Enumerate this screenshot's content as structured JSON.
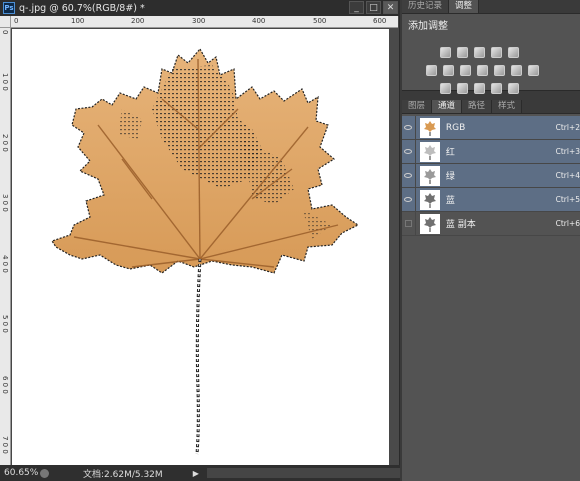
{
  "window": {
    "title": "q-.jpg @ 60.7%(RGB/8#) *",
    "minimize": "_",
    "restore": "□",
    "close": "✕",
    "ps_logo": "Ps"
  },
  "rulers": {
    "top": [
      "0",
      "100",
      "200",
      "300",
      "400",
      "500",
      "600"
    ],
    "left": [
      "0",
      "1\n0\n0",
      "2\n0\n0",
      "3\n0\n0",
      "4\n0\n0",
      "5\n0\n0",
      "6\n0\n0",
      "7\n0\n0",
      "8\n0\n0"
    ]
  },
  "status": {
    "zoom": "60.65%",
    "docinfo": "文档:2.62M/5.32M",
    "arrow": "▶"
  },
  "panels": {
    "top_tabs": [
      "历史记录",
      "调整"
    ],
    "adjustments_title": "添加调整",
    "mid_tabs": [
      "图层",
      "通道",
      "路径",
      "样式"
    ],
    "channels": [
      {
        "name": "RGB",
        "key": "Ctrl+2",
        "selected": true,
        "visible": true,
        "thumb_color": "#d99a52"
      },
      {
        "name": "红",
        "key": "Ctrl+3",
        "selected": true,
        "visible": true,
        "thumb_color": "#bdbdbd"
      },
      {
        "name": "绿",
        "key": "Ctrl+4",
        "selected": true,
        "visible": true,
        "thumb_color": "#9a9a9a"
      },
      {
        "name": "蓝",
        "key": "Ctrl+5",
        "selected": true,
        "visible": true,
        "thumb_color": "#707070"
      },
      {
        "name": "蓝 副本",
        "key": "Ctrl+6",
        "selected": false,
        "visible": false,
        "thumb_color": "#707070"
      }
    ]
  },
  "colors": {
    "leaf": "#e0a866",
    "leaf_dark": "#b9783c",
    "channel_selected": "#5d6e85"
  }
}
